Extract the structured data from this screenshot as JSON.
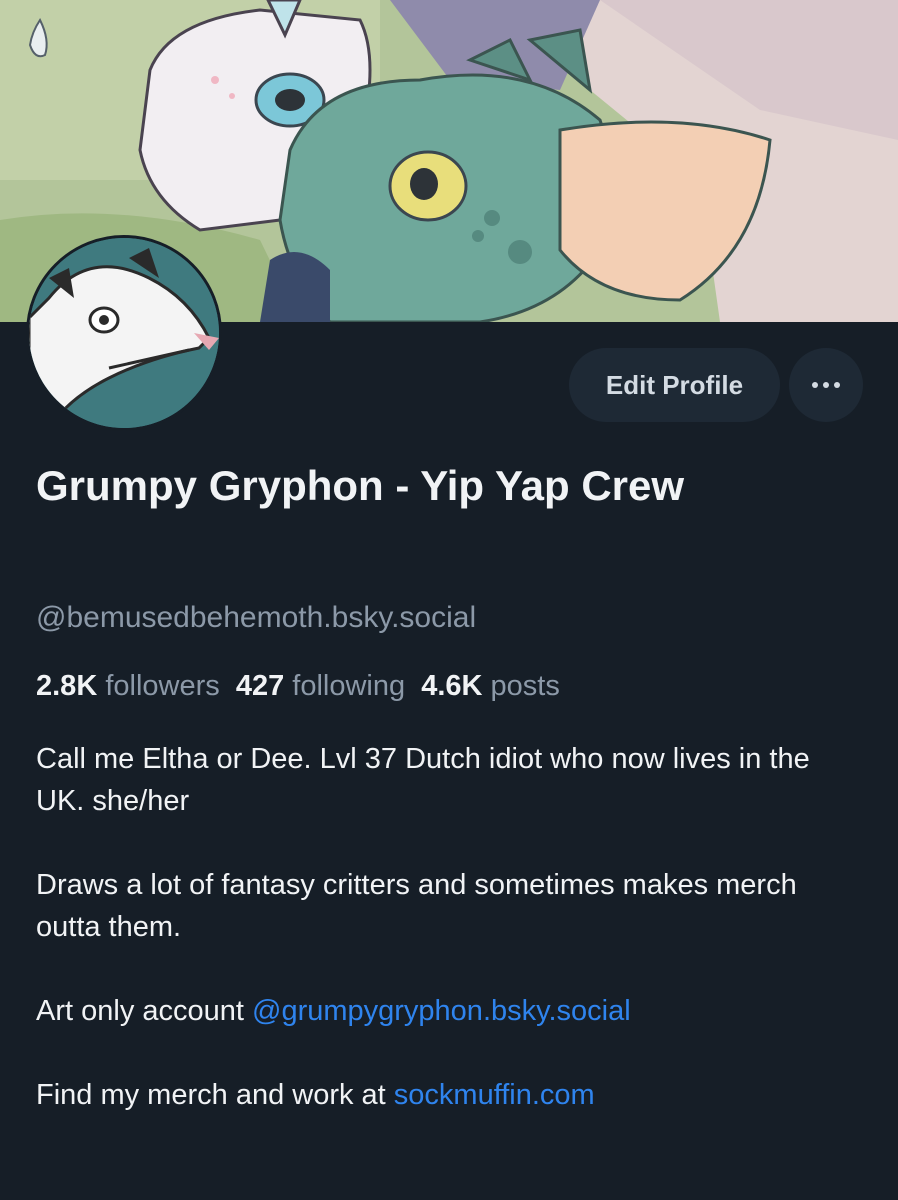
{
  "profile": {
    "display_name": "Grumpy Gryphon - Yip Yap Crew",
    "handle": "@bemusedbehemoth.bsky.social",
    "banner_image": "illustrated banner: white unicorn creature and teal dragon creature in grass",
    "avatar_image": "cartoon opossum on teal background"
  },
  "actions": {
    "edit_profile_label": "Edit Profile",
    "more_label": "more-options"
  },
  "stats": {
    "followers_count": "2.8K",
    "followers_label": "followers",
    "following_count": "427",
    "following_label": "following",
    "posts_count": "4.6K",
    "posts_label": "posts"
  },
  "bio": {
    "line1": "Call me Eltha or Dee. Lvl 37 Dutch idiot who now lives in the UK. she/her",
    "line2": "Draws a lot of fantasy critters and sometimes makes merch outta them.",
    "line3_prefix": "Art only account ",
    "line3_link": "@grumpygryphon.bsky.social",
    "line4_prefix": "Find my merch and work at ",
    "line4_link": "sockmuffin.com"
  },
  "colors": {
    "background": "#161e27",
    "button_bg": "#1e2935",
    "text_primary": "#f1f3f5",
    "text_secondary": "#8c99a8",
    "link": "#2f84ee"
  }
}
